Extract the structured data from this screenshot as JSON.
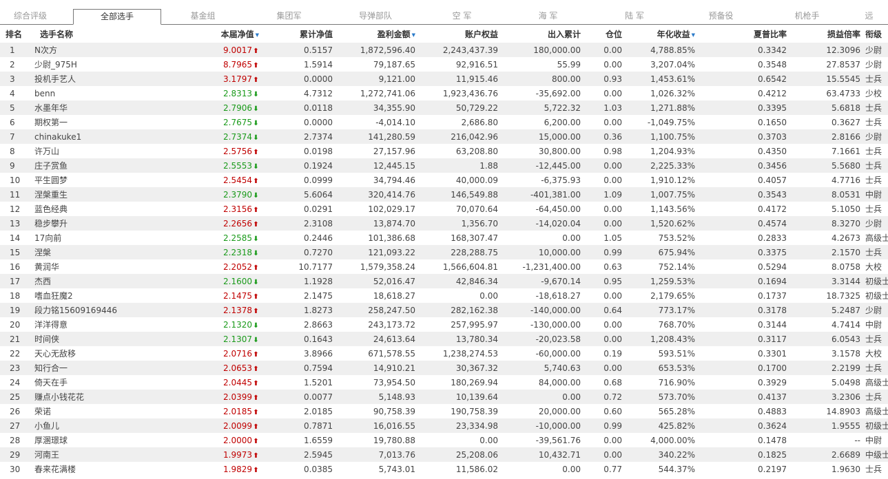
{
  "colors": {
    "up": "#c00000",
    "down": "#1a9a1a",
    "sort": "#2a7ac9",
    "row_alt": "#efefef"
  },
  "tabs": [
    {
      "label": "综合评级",
      "active": false
    },
    {
      "label": "全部选手",
      "active": true
    },
    {
      "label": "基金组",
      "active": false
    },
    {
      "label": "集团军",
      "active": false
    },
    {
      "label": "导弹部队",
      "active": false
    },
    {
      "label": "空 军",
      "active": false
    },
    {
      "label": "海 军",
      "active": false
    },
    {
      "label": "陆 军",
      "active": false
    },
    {
      "label": "预备役",
      "active": false
    },
    {
      "label": "机枪手",
      "active": false
    },
    {
      "label": "远",
      "active": false
    }
  ],
  "columns": {
    "rank": "排名",
    "name": "选手名称",
    "nav": "本届净值",
    "cum_nav": "累计净值",
    "profit": "盈利金额",
    "equity": "账户权益",
    "flow": "出入累计",
    "position": "仓位",
    "annual": "年化收益",
    "sharpe": "夏普比率",
    "pl_ratio": "损益倍率",
    "rank_title": "衔级"
  },
  "sort_icon": "sort-desc-icon",
  "rows": [
    {
      "rank": "1",
      "name": "N次方",
      "nav": "9.0017",
      "dir": "up",
      "cum_nav": "0.5157",
      "profit": "1,872,596.40",
      "equity": "2,243,437.39",
      "flow": "180,000.00",
      "position": "0.00",
      "annual": "4,788.85%",
      "sharpe": "0.3342",
      "pl_ratio": "12.3096",
      "title": "少尉"
    },
    {
      "rank": "2",
      "name": "少尉_975H",
      "nav": "8.7965",
      "dir": "up",
      "cum_nav": "1.5914",
      "profit": "79,187.65",
      "equity": "92,916.51",
      "flow": "55.99",
      "position": "0.00",
      "annual": "3,207.04%",
      "sharpe": "0.3548",
      "pl_ratio": "27.8537",
      "title": "少尉"
    },
    {
      "rank": "3",
      "name": "投机手艺人",
      "nav": "3.1797",
      "dir": "up",
      "cum_nav": "0.0000",
      "profit": "9,121.00",
      "equity": "11,915.46",
      "flow": "800.00",
      "position": "0.93",
      "annual": "1,453.61%",
      "sharpe": "0.6542",
      "pl_ratio": "15.5545",
      "title": "士兵"
    },
    {
      "rank": "4",
      "name": "benn",
      "nav": "2.8313",
      "dir": "down",
      "cum_nav": "4.7312",
      "profit": "1,272,741.06",
      "equity": "1,923,436.76",
      "flow": "-35,692.00",
      "position": "0.00",
      "annual": "1,026.32%",
      "sharpe": "0.4212",
      "pl_ratio": "63.4733",
      "title": "少校"
    },
    {
      "rank": "5",
      "name": "水墨年华",
      "nav": "2.7906",
      "dir": "down",
      "cum_nav": "0.0118",
      "profit": "34,355.90",
      "equity": "50,729.22",
      "flow": "5,722.32",
      "position": "1.03",
      "annual": "1,271.88%",
      "sharpe": "0.3395",
      "pl_ratio": "5.6818",
      "title": "士兵"
    },
    {
      "rank": "6",
      "name": "期权第一",
      "nav": "2.7675",
      "dir": "down",
      "cum_nav": "0.0000",
      "profit": "-4,014.10",
      "equity": "2,686.80",
      "flow": "6,200.00",
      "position": "0.00",
      "annual": "-1,049.75%",
      "sharpe": "0.1650",
      "pl_ratio": "0.3627",
      "title": "士兵"
    },
    {
      "rank": "7",
      "name": "chinakuke1",
      "nav": "2.7374",
      "dir": "down",
      "cum_nav": "2.7374",
      "profit": "141,280.59",
      "equity": "216,042.96",
      "flow": "15,000.00",
      "position": "0.36",
      "annual": "1,100.75%",
      "sharpe": "0.3703",
      "pl_ratio": "2.8166",
      "title": "少尉"
    },
    {
      "rank": "8",
      "name": "许万山",
      "nav": "2.5756",
      "dir": "up",
      "cum_nav": "0.0198",
      "profit": "27,157.96",
      "equity": "63,208.80",
      "flow": "30,800.00",
      "position": "0.98",
      "annual": "1,204.93%",
      "sharpe": "0.4350",
      "pl_ratio": "7.1661",
      "title": "士兵"
    },
    {
      "rank": "9",
      "name": "庄子赏鱼",
      "nav": "2.5553",
      "dir": "down",
      "cum_nav": "0.1924",
      "profit": "12,445.15",
      "equity": "1.88",
      "flow": "-12,445.00",
      "position": "0.00",
      "annual": "2,225.33%",
      "sharpe": "0.3456",
      "pl_ratio": "5.5680",
      "title": "士兵"
    },
    {
      "rank": "10",
      "name": "平生圆梦",
      "nav": "2.5454",
      "dir": "up",
      "cum_nav": "0.0999",
      "profit": "34,794.46",
      "equity": "40,000.09",
      "flow": "-6,375.93",
      "position": "0.00",
      "annual": "1,910.12%",
      "sharpe": "0.4057",
      "pl_ratio": "4.7716",
      "title": "士兵"
    },
    {
      "rank": "11",
      "name": "涅槃重生",
      "nav": "2.3790",
      "dir": "down",
      "cum_nav": "5.6064",
      "profit": "320,414.76",
      "equity": "146,549.88",
      "flow": "-401,381.00",
      "position": "1.09",
      "annual": "1,007.75%",
      "sharpe": "0.3543",
      "pl_ratio": "8.0531",
      "title": "中尉"
    },
    {
      "rank": "12",
      "name": "蓝色经典",
      "nav": "2.3156",
      "dir": "up",
      "cum_nav": "0.0291",
      "profit": "102,029.17",
      "equity": "70,070.64",
      "flow": "-64,450.00",
      "position": "0.00",
      "annual": "1,143.56%",
      "sharpe": "0.4172",
      "pl_ratio": "5.1050",
      "title": "士兵"
    },
    {
      "rank": "13",
      "name": "稳步攀升",
      "nav": "2.2656",
      "dir": "up",
      "cum_nav": "2.3108",
      "profit": "13,874.70",
      "equity": "1,356.70",
      "flow": "-14,020.04",
      "position": "0.00",
      "annual": "1,520.62%",
      "sharpe": "0.4574",
      "pl_ratio": "8.3270",
      "title": "少尉"
    },
    {
      "rank": "14",
      "name": "17向前",
      "nav": "2.2585",
      "dir": "down",
      "cum_nav": "0.2446",
      "profit": "101,386.68",
      "equity": "168,307.47",
      "flow": "0.00",
      "position": "1.05",
      "annual": "753.52%",
      "sharpe": "0.2833",
      "pl_ratio": "4.2673",
      "title": "高级士官"
    },
    {
      "rank": "15",
      "name": "涅槃",
      "nav": "2.2318",
      "dir": "down",
      "cum_nav": "0.7270",
      "profit": "121,093.22",
      "equity": "228,288.75",
      "flow": "10,000.00",
      "position": "0.99",
      "annual": "675.94%",
      "sharpe": "0.3375",
      "pl_ratio": "2.1570",
      "title": "士兵"
    },
    {
      "rank": "16",
      "name": "黄润华",
      "nav": "2.2052",
      "dir": "up",
      "cum_nav": "10.7177",
      "profit": "1,579,358.24",
      "equity": "1,566,604.81",
      "flow": "-1,231,400.00",
      "position": "0.63",
      "annual": "752.14%",
      "sharpe": "0.5294",
      "pl_ratio": "8.0758",
      "title": "大校"
    },
    {
      "rank": "17",
      "name": "杰西",
      "nav": "2.1600",
      "dir": "down",
      "cum_nav": "1.1928",
      "profit": "52,016.47",
      "equity": "42,846.34",
      "flow": "-9,670.14",
      "position": "0.95",
      "annual": "1,259.53%",
      "sharpe": "0.1694",
      "pl_ratio": "3.3144",
      "title": "初级士官"
    },
    {
      "rank": "18",
      "name": "嗜血狂魔2",
      "nav": "2.1475",
      "dir": "up",
      "cum_nav": "2.1475",
      "profit": "18,618.27",
      "equity": "0.00",
      "flow": "-18,618.27",
      "position": "0.00",
      "annual": "2,179.65%",
      "sharpe": "0.1737",
      "pl_ratio": "18.7325",
      "title": "初级士官"
    },
    {
      "rank": "19",
      "name": "段力铭15609169446",
      "nav": "2.1378",
      "dir": "up",
      "cum_nav": "1.8273",
      "profit": "258,247.50",
      "equity": "282,162.38",
      "flow": "-140,000.00",
      "position": "0.64",
      "annual": "773.17%",
      "sharpe": "0.3178",
      "pl_ratio": "5.2487",
      "title": "少尉"
    },
    {
      "rank": "20",
      "name": "洋洋得意",
      "nav": "2.1320",
      "dir": "down",
      "cum_nav": "2.8663",
      "profit": "243,173.72",
      "equity": "257,995.97",
      "flow": "-130,000.00",
      "position": "0.00",
      "annual": "768.70%",
      "sharpe": "0.3144",
      "pl_ratio": "4.7414",
      "title": "中尉"
    },
    {
      "rank": "21",
      "name": "时间侠",
      "nav": "2.1307",
      "dir": "down",
      "cum_nav": "0.1643",
      "profit": "24,613.64",
      "equity": "13,780.34",
      "flow": "-20,023.58",
      "position": "0.00",
      "annual": "1,208.43%",
      "sharpe": "0.3117",
      "pl_ratio": "6.0543",
      "title": "士兵"
    },
    {
      "rank": "22",
      "name": "天心无敌移",
      "nav": "2.0716",
      "dir": "up",
      "cum_nav": "3.8966",
      "profit": "671,578.55",
      "equity": "1,238,274.53",
      "flow": "-60,000.00",
      "position": "0.19",
      "annual": "593.51%",
      "sharpe": "0.3301",
      "pl_ratio": "3.1578",
      "title": "大校"
    },
    {
      "rank": "23",
      "name": "知行合一",
      "nav": "2.0653",
      "dir": "up",
      "cum_nav": "0.7594",
      "profit": "14,910.21",
      "equity": "30,367.32",
      "flow": "5,740.63",
      "position": "0.00",
      "annual": "653.53%",
      "sharpe": "0.1700",
      "pl_ratio": "2.2199",
      "title": "士兵"
    },
    {
      "rank": "24",
      "name": "倚天在手",
      "nav": "2.0445",
      "dir": "up",
      "cum_nav": "1.5201",
      "profit": "73,954.50",
      "equity": "180,269.94",
      "flow": "84,000.00",
      "position": "0.68",
      "annual": "716.90%",
      "sharpe": "0.3929",
      "pl_ratio": "5.0498",
      "title": "高级士官"
    },
    {
      "rank": "25",
      "name": "赚点小钱花花",
      "nav": "2.0399",
      "dir": "up",
      "cum_nav": "0.0077",
      "profit": "5,148.93",
      "equity": "10,139.64",
      "flow": "0.00",
      "position": "0.72",
      "annual": "573.70%",
      "sharpe": "0.4137",
      "pl_ratio": "3.2306",
      "title": "士兵"
    },
    {
      "rank": "26",
      "name": "荣诺",
      "nav": "2.0185",
      "dir": "up",
      "cum_nav": "2.0185",
      "profit": "90,758.39",
      "equity": "190,758.39",
      "flow": "20,000.00",
      "position": "0.60",
      "annual": "565.28%",
      "sharpe": "0.4883",
      "pl_ratio": "14.8903",
      "title": "高级士官"
    },
    {
      "rank": "27",
      "name": "小鱼儿",
      "nav": "2.0099",
      "dir": "up",
      "cum_nav": "0.7871",
      "profit": "16,016.55",
      "equity": "23,334.98",
      "flow": "-10,000.00",
      "position": "0.99",
      "annual": "425.82%",
      "sharpe": "0.3624",
      "pl_ratio": "1.9555",
      "title": "初级士官"
    },
    {
      "rank": "28",
      "name": "厚溷璟球",
      "nav": "2.0000",
      "dir": "up",
      "cum_nav": "1.6559",
      "profit": "19,780.88",
      "equity": "0.00",
      "flow": "-39,561.76",
      "position": "0.00",
      "annual": "4,000.00%",
      "sharpe": "0.1478",
      "pl_ratio": "--",
      "title": "中尉"
    },
    {
      "rank": "29",
      "name": "河南王",
      "nav": "1.9973",
      "dir": "up",
      "cum_nav": "2.5945",
      "profit": "7,013.76",
      "equity": "25,208.06",
      "flow": "10,432.71",
      "position": "0.00",
      "annual": "340.22%",
      "sharpe": "0.1825",
      "pl_ratio": "2.6689",
      "title": "中级士官"
    },
    {
      "rank": "30",
      "name": "春来花满楼",
      "nav": "1.9829",
      "dir": "up",
      "cum_nav": "0.0385",
      "profit": "5,743.01",
      "equity": "11,586.02",
      "flow": "0.00",
      "position": "0.77",
      "annual": "544.37%",
      "sharpe": "0.2197",
      "pl_ratio": "1.9630",
      "title": "士兵"
    }
  ]
}
